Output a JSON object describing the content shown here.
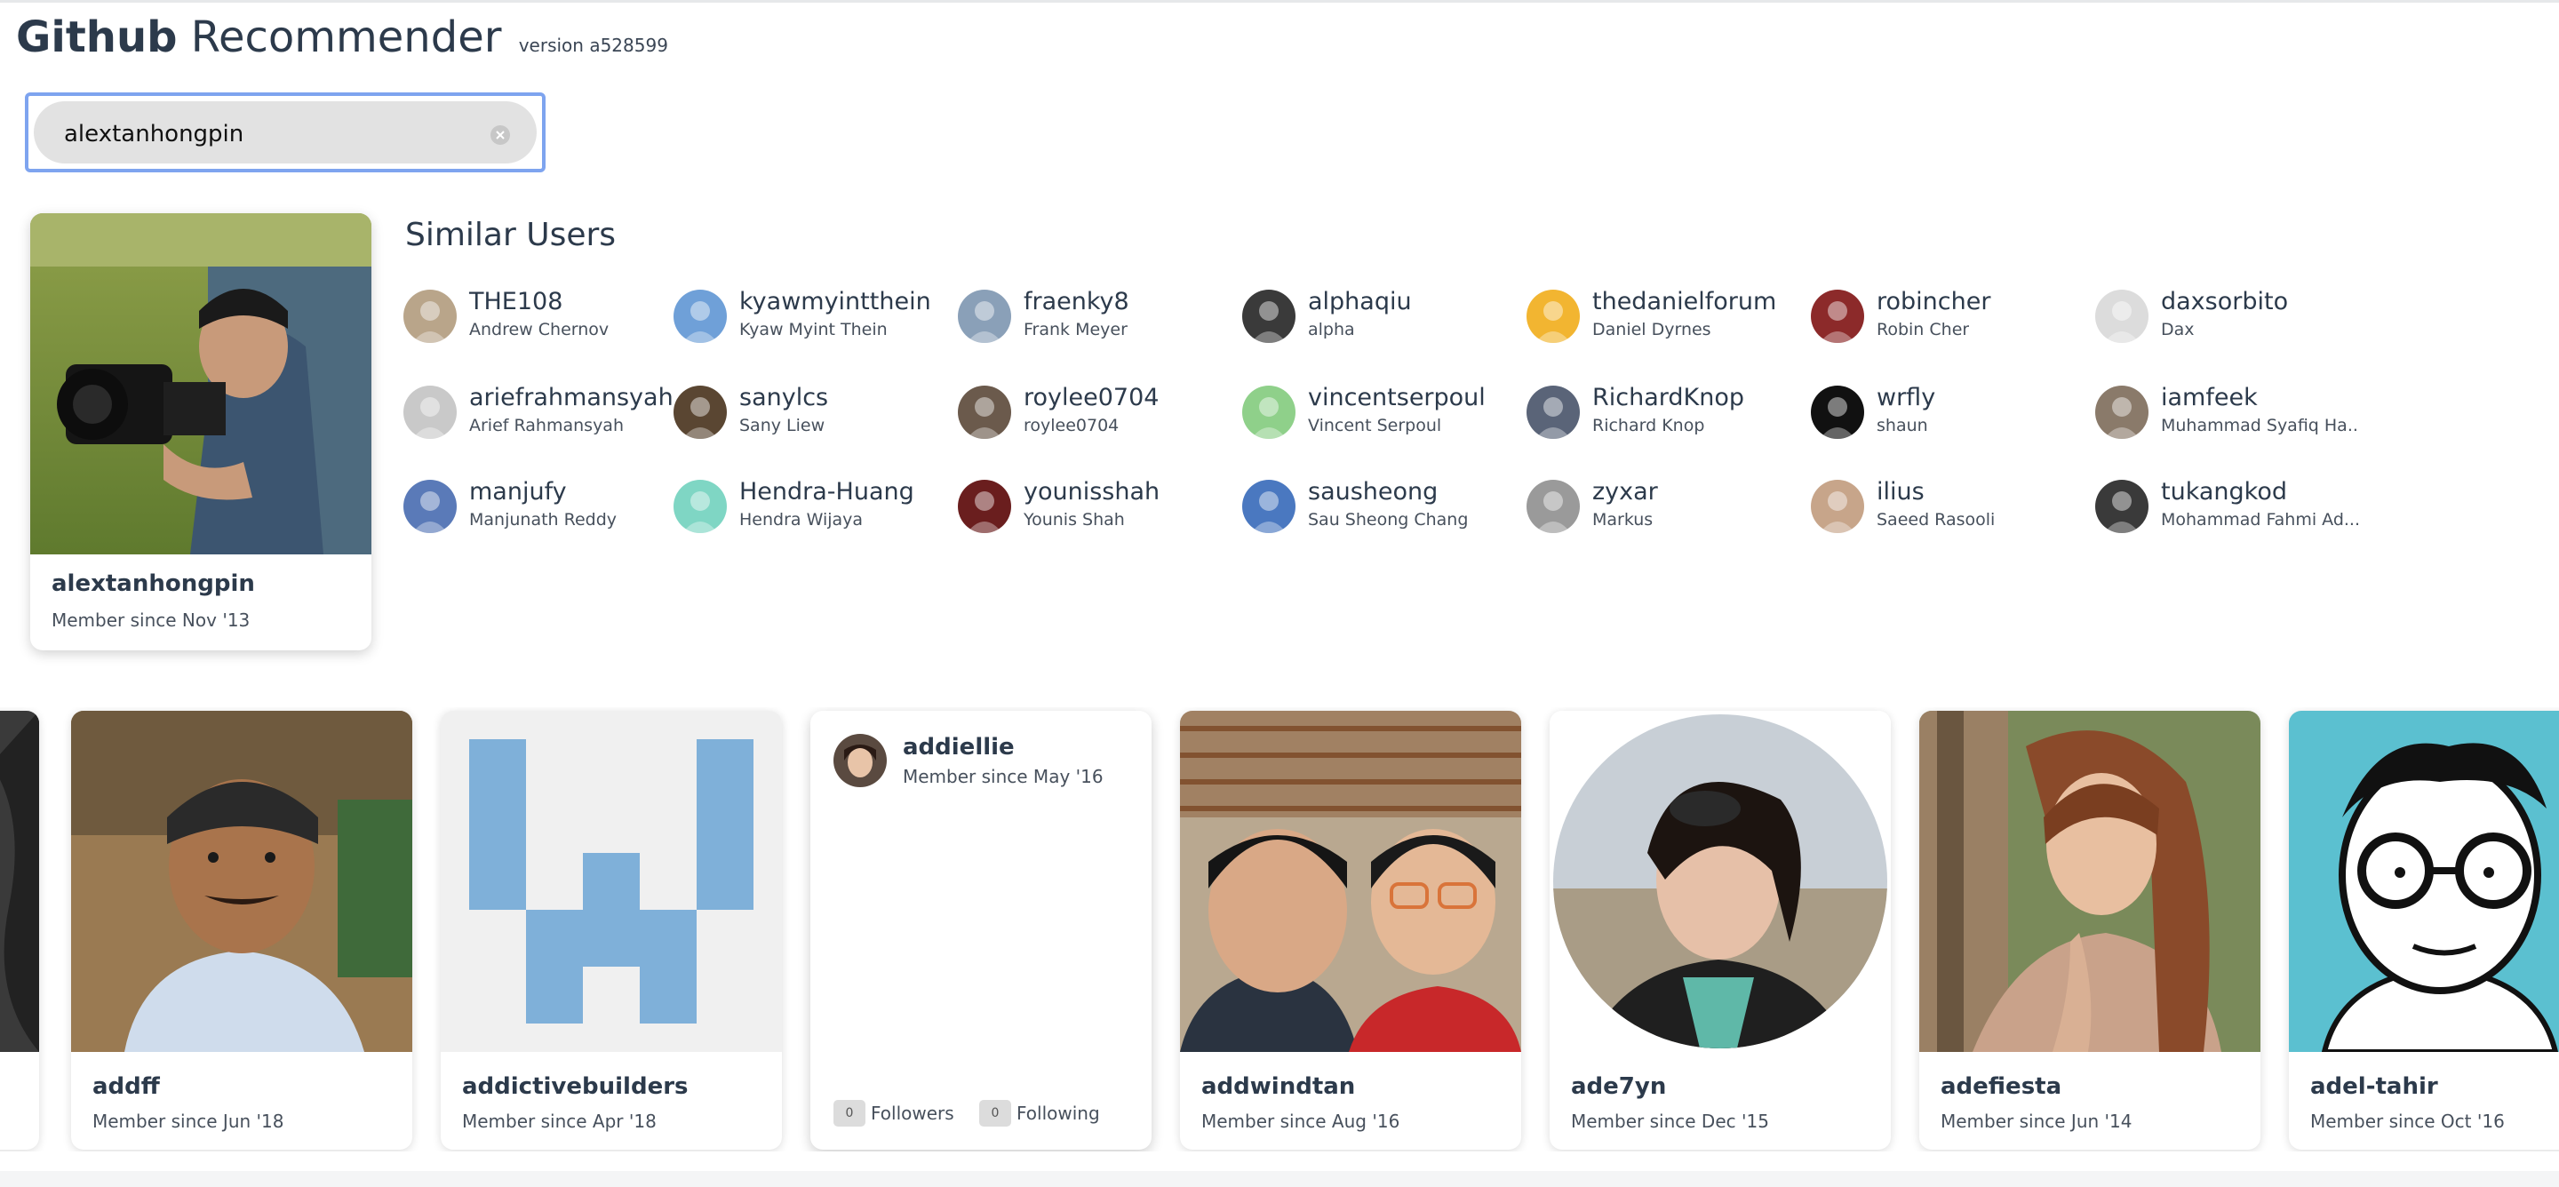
{
  "app": {
    "title_bold": "Github",
    "title_light": "Recommender",
    "version": "version a528599"
  },
  "search": {
    "value": "alextanhongpin",
    "clear_icon": "clear-circle-icon"
  },
  "selected_user": {
    "login": "alextanhongpin",
    "member_since": "Member since Nov '13"
  },
  "similar": {
    "title": "Similar Users",
    "users": [
      {
        "login": "THE108",
        "name": "Andrew Chernov",
        "color": "#b9a58a"
      },
      {
        "login": "kyawmyintthein",
        "name": "Kyaw Myint Thein",
        "color": "#6fa0d8"
      },
      {
        "login": "fraenky8",
        "name": "Frank Meyer",
        "color": "#8aa0b8"
      },
      {
        "login": "alphaqiu",
        "name": "alpha",
        "color": "#3a3a3a"
      },
      {
        "login": "thedanielforum",
        "name": "Daniel Dyrnes",
        "color": "#f2b531"
      },
      {
        "login": "robincher",
        "name": "Robin Cher",
        "color": "#8c2a2a"
      },
      {
        "login": "daxsorbito",
        "name": "Dax",
        "color": "#dcdcdc"
      },
      {
        "login": "ariefrahmansyah",
        "name": "Arief Rahmansyah",
        "color": "#c9c9c9"
      },
      {
        "login": "sanylcs",
        "name": "Sany Liew",
        "color": "#5a4632"
      },
      {
        "login": "roylee0704",
        "name": "roylee0704",
        "color": "#6b5a4c"
      },
      {
        "login": "vincentserpoul",
        "name": "Vincent Serpoul",
        "color": "#8fd08a"
      },
      {
        "login": "RichardKnop",
        "name": "Richard Knop",
        "color": "#5a6478"
      },
      {
        "login": "wrfly",
        "name": "shaun",
        "color": "#111111"
      },
      {
        "login": "iamfeek",
        "name": "Muhammad Syafiq Ha...",
        "color": "#8a7a6a"
      },
      {
        "login": "manjufy",
        "name": "Manjunath Reddy",
        "color": "#5a7ab8"
      },
      {
        "login": "Hendra-Huang",
        "name": "Hendra Wijaya",
        "color": "#7fd6c4"
      },
      {
        "login": "younisshah",
        "name": "Younis Shah",
        "color": "#6a1e1e"
      },
      {
        "login": "sausheong",
        "name": "Sau Sheong Chang",
        "color": "#4a78c0"
      },
      {
        "login": "zyxar",
        "name": "Markus",
        "color": "#9a9a9a"
      },
      {
        "login": "ilius",
        "name": "Saeed Rasooli",
        "color": "#c7a58a"
      },
      {
        "login": "tukangkod",
        "name": "Mohammad Fahmi Ad...",
        "color": "#3a3a3a"
      }
    ]
  },
  "carousel": {
    "cards": [
      {
        "login": "",
        "member_since": "",
        "kind": "partial-left"
      },
      {
        "login": "addff",
        "member_since": "Member since Jun '18",
        "kind": "photo"
      },
      {
        "login": "addictivebuilders",
        "member_since": "Member since Apr '18",
        "kind": "identicon"
      },
      {
        "login": "addiellie",
        "member_since": "Member since May '16",
        "kind": "compact",
        "followers_count": "0",
        "followers_label": "Followers",
        "following_count": "0",
        "following_label": "Following"
      },
      {
        "login": "addwindtan",
        "member_since": "Member since Aug '16",
        "kind": "photo"
      },
      {
        "login": "ade7yn",
        "member_since": "Member since Dec '15",
        "kind": "photo-round"
      },
      {
        "login": "adefiesta",
        "member_since": "Member since Jun '14",
        "kind": "photo"
      },
      {
        "login": "adel-tahir",
        "member_since": "Member since Oct '16",
        "kind": "cartoon"
      }
    ]
  },
  "colors": {
    "accent_focus": "#7ea4ef",
    "heading": "#2c3a4b",
    "identicon": "#7fb0d9"
  }
}
